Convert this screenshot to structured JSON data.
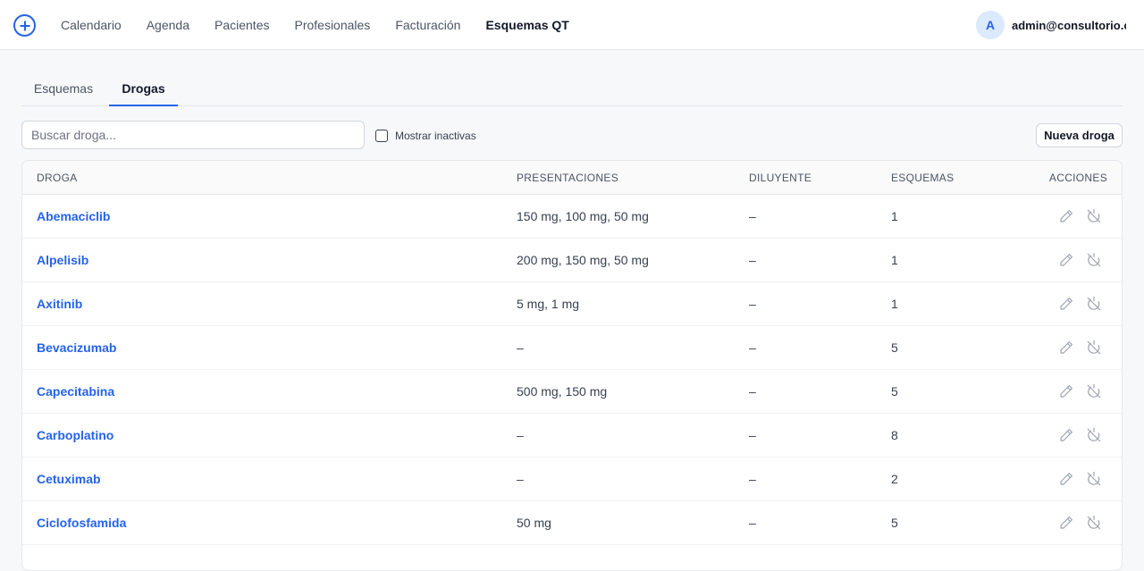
{
  "nav": {
    "items": [
      {
        "label": "Calendario",
        "name": "nav-calendario",
        "active": false
      },
      {
        "label": "Agenda",
        "name": "nav-agenda",
        "active": false
      },
      {
        "label": "Pacientes",
        "name": "nav-pacientes",
        "active": false
      },
      {
        "label": "Profesionales",
        "name": "nav-profesionales",
        "active": false
      },
      {
        "label": "Facturación",
        "name": "nav-facturacion",
        "active": false
      },
      {
        "label": "Esquemas QT",
        "name": "nav-esquemas-qt",
        "active": true
      }
    ],
    "logo_icon": "plus-circle-icon",
    "accent_color": "#2563eb"
  },
  "user": {
    "initial": "A",
    "email": "admin@consultorio.c..."
  },
  "tabs": {
    "esquemas": "Esquemas",
    "drogas": "Drogas",
    "active": "drogas"
  },
  "toolbar": {
    "search_placeholder": "Buscar droga...",
    "search_value": "",
    "show_inactive_label": "Mostrar inactivas",
    "show_inactive_checked": false,
    "new_button": "Nueva droga"
  },
  "table": {
    "headers": {
      "droga": "DROGA",
      "presentaciones": "PRESENTACIONES",
      "diluyente": "DILUYENTE",
      "esquemas": "ESQUEMAS",
      "acciones": "ACCIONES"
    },
    "action_icons": [
      "edit-icon",
      "deactivate-icon"
    ],
    "rows": [
      {
        "droga": "Abemaciclib",
        "presentaciones": "150 mg, 100 mg, 50 mg",
        "diluyente": "–",
        "esquemas": "1"
      },
      {
        "droga": "Alpelisib",
        "presentaciones": "200 mg, 150 mg, 50 mg",
        "diluyente": "–",
        "esquemas": "1"
      },
      {
        "droga": "Axitinib",
        "presentaciones": "5 mg, 1 mg",
        "diluyente": "–",
        "esquemas": "1"
      },
      {
        "droga": "Bevacizumab",
        "presentaciones": "–",
        "diluyente": "–",
        "esquemas": "5"
      },
      {
        "droga": "Capecitabina",
        "presentaciones": "500 mg, 150 mg",
        "diluyente": "–",
        "esquemas": "5"
      },
      {
        "droga": "Carboplatino",
        "presentaciones": "–",
        "diluyente": "–",
        "esquemas": "8"
      },
      {
        "droga": "Cetuximab",
        "presentaciones": "–",
        "diluyente": "–",
        "esquemas": "2"
      },
      {
        "droga": "Ciclofosfamida",
        "presentaciones": "50 mg",
        "diluyente": "–",
        "esquemas": "5"
      }
    ]
  }
}
